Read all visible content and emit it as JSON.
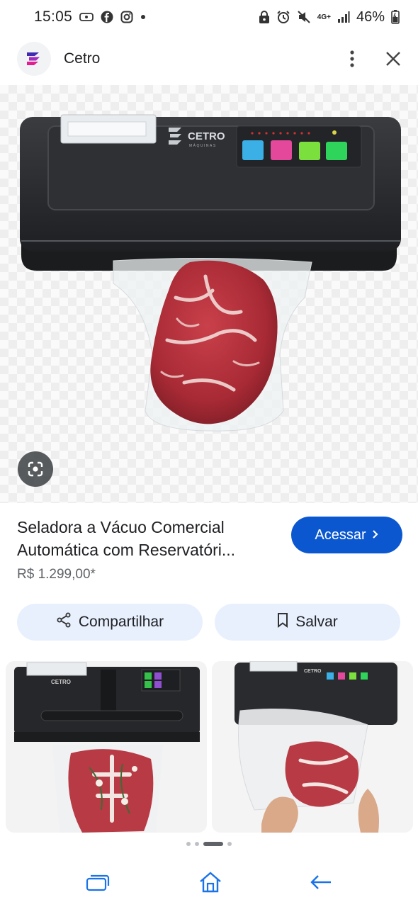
{
  "status_bar": {
    "time": "15:05",
    "network": "4G+",
    "battery": "46%",
    "icons": [
      "screencast-icon",
      "facebook-icon",
      "instagram-icon",
      "dot-icon",
      "lock-icon",
      "alarm-icon",
      "mute-icon",
      "signal-icon",
      "battery-icon"
    ]
  },
  "header": {
    "site_name": "Cetro",
    "icons": [
      "cetro-logo",
      "more-vert-icon",
      "close-icon"
    ]
  },
  "hero": {
    "brand": "CETRO",
    "brand_sub": "MÁQUINAS",
    "lens_icon": "google-lens-icon"
  },
  "product": {
    "title_line1": "Seladora a Vácuo Comercial",
    "title_line2": "Automática com Reservatóri...",
    "price": "R$ 1.299,00*",
    "visit_label": "Acessar"
  },
  "actions": {
    "share_label": "Compartilhar",
    "save_label": "Salvar"
  },
  "carousel": {
    "count": 4,
    "active_index": 2
  },
  "navbar": {
    "icons": [
      "recent-apps-icon",
      "home-icon",
      "back-icon"
    ]
  },
  "colors": {
    "accent": "#0b57d0",
    "pill_bg": "#e8f0fe",
    "machine": "#2b2d30",
    "meat": "#b8343c"
  }
}
